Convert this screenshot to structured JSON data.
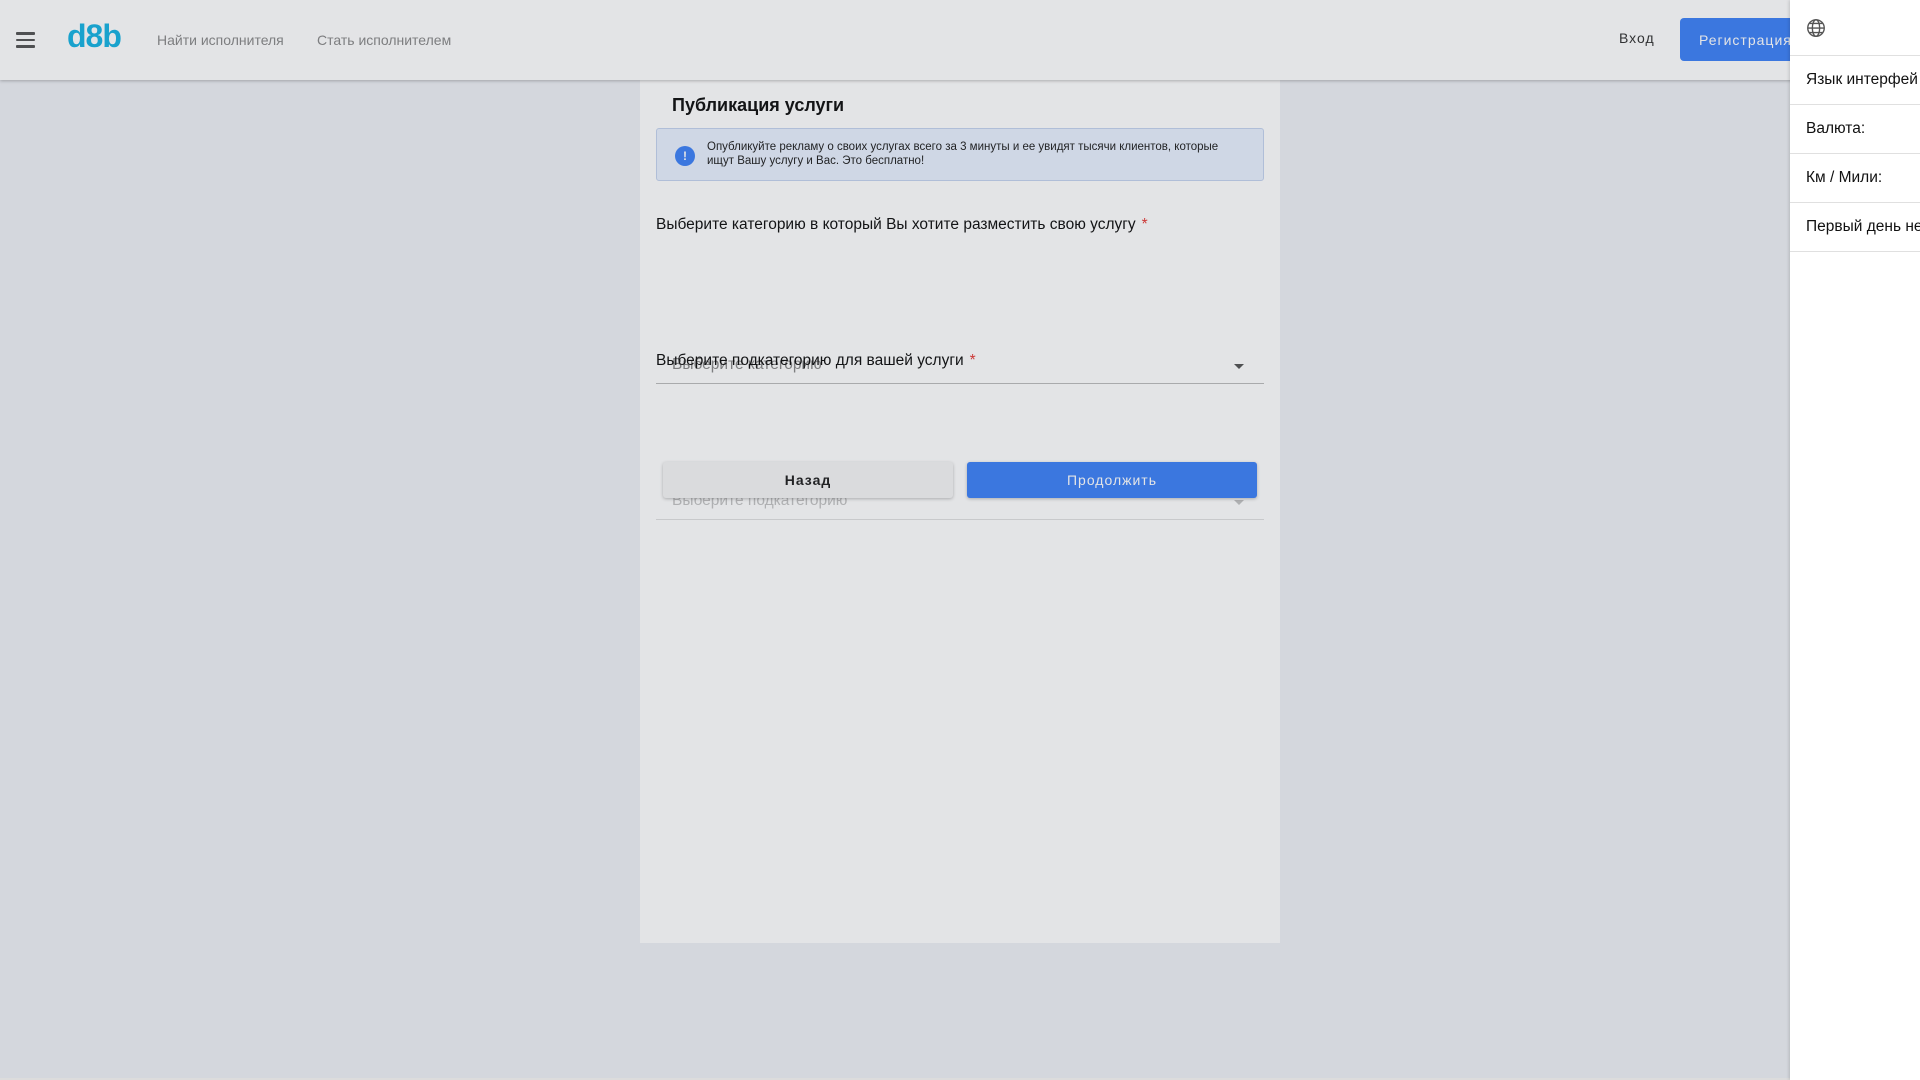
{
  "header": {
    "logo": "d8b",
    "nav": {
      "find_performer": "Найти исполнителя",
      "become_performer": "Стать исполнителем"
    },
    "login": "Вход",
    "register": "Регистрация"
  },
  "form": {
    "title": "Публикация услуги",
    "alert_icon": "!",
    "alert_text": "Опубликуйте рекламу о своих услугах всего за 3 минуты и ее увидят тысячи клиентов, которые ищут Вашу услугу и Вас. Это бесплатно!",
    "category": {
      "label": "Выберите категорию в который Вы хотите разместить свою услугу",
      "required_mark": "*",
      "placeholder": "Выберите категорию"
    },
    "subcategory": {
      "label": "Выберите подкатегорию для вашей услуги",
      "required_mark": "*",
      "placeholder": "Выберите подкатегорию"
    },
    "back_button": "Назад",
    "continue_button": "Продолжить"
  },
  "settings_drawer": {
    "icon": "globe-icon",
    "items": [
      "Язык интерфей",
      "Валюта:",
      "Км / Мили:",
      "Первый день не"
    ]
  },
  "colors": {
    "accent": "#3e82f7",
    "logo": "#17b4e3",
    "required": "#e53935"
  }
}
